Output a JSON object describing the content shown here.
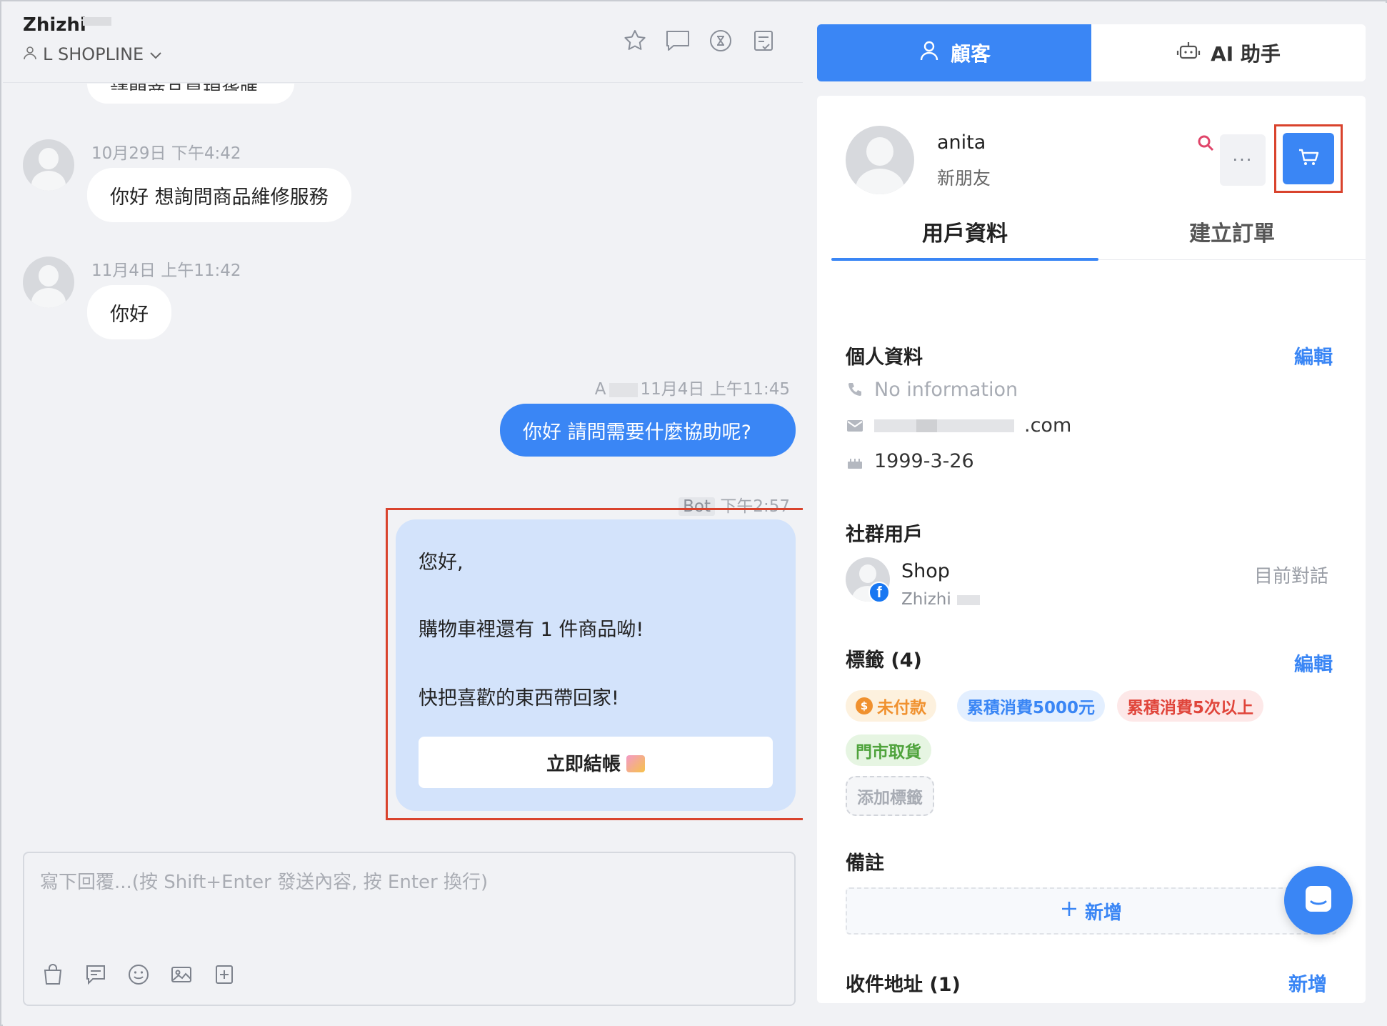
{
  "conversation": {
    "customer_name": "Zhizhi",
    "store": "L SHOPLINE",
    "header_icons": [
      "star-icon",
      "comment-icon",
      "close-circle-icon",
      "task-icon"
    ]
  },
  "messages": {
    "cut_text": "請問商品是現貨嗎",
    "m1": {
      "timestamp": "10月29日 下午4:42",
      "text": "你好 想詢問商品維修服務"
    },
    "m2": {
      "timestamp": "11月4日 上午11:42",
      "text": "你好"
    },
    "m3": {
      "sender": "A",
      "timestamp": "11月4日 上午11:45",
      "text": "你好 請問需要什麼協助呢?"
    },
    "bot": {
      "tag": "Bot",
      "timestamp": "下午2:57",
      "line1": "您好,",
      "line2": "購物車裡還有 1 件商品呦!",
      "line3": "快把喜歡的東西帶回家!",
      "button": "立即結帳"
    }
  },
  "composer": {
    "placeholder": "寫下回覆...(按 Shift+Enter 發送內容, 按 Enter 換行)",
    "tools": [
      "bag-icon",
      "quick-reply-icon",
      "emoji-icon",
      "image-icon",
      "add-icon"
    ]
  },
  "right_tabs": {
    "customer": "顧客",
    "ai": "AI 助手"
  },
  "profile": {
    "name": "anita",
    "level": "新朋友",
    "more": "···"
  },
  "sub_tabs": {
    "info": "用戶資料",
    "order": "建立訂單"
  },
  "personal": {
    "title": "個人資料",
    "edit": "編輯",
    "phone": "No information",
    "email_suffix": ".com",
    "birthday": "1999-3-26"
  },
  "social": {
    "title": "社群用戶",
    "name": "Shop",
    "sub": "Zhizhi",
    "status": "目前對話"
  },
  "tags": {
    "title": "標籤 (4)",
    "edit": "編輯",
    "unpaid": "未付款",
    "spend": "累積消費5000元",
    "times": "累積消費5次以上",
    "pickup": "門市取貨",
    "add": "添加標籤"
  },
  "notes": {
    "title": "備註",
    "add": "新增"
  },
  "address": {
    "title": "收件地址 (1)",
    "add": "新增"
  },
  "colors": {
    "primary": "#3a86f5",
    "highlight": "#d9432d",
    "bot_bubble": "#d3e3fb"
  }
}
